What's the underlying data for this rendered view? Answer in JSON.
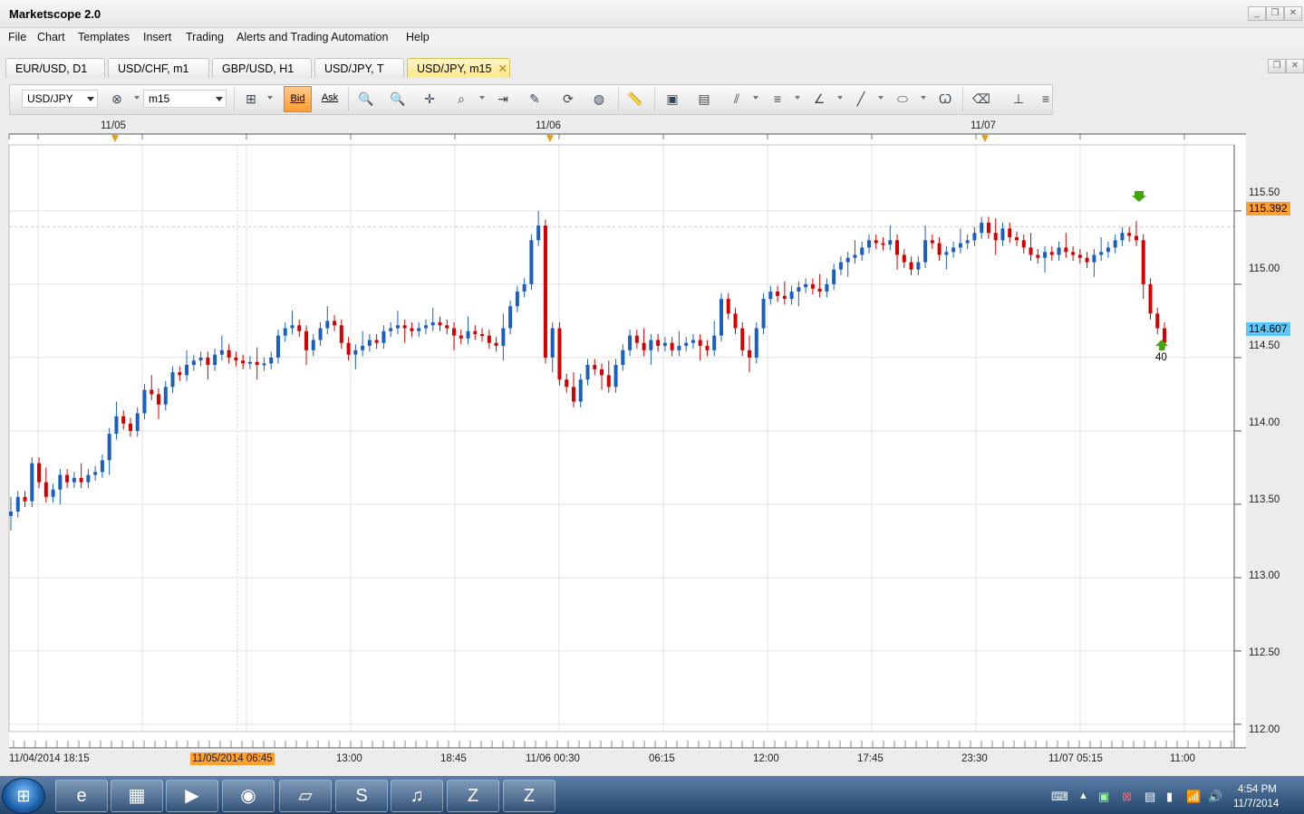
{
  "window": {
    "title": "Marketscope 2.0"
  },
  "menu": [
    "File",
    "Chart",
    "Templates",
    "Insert",
    "Trading",
    "Alerts and Trading Automation",
    "Help"
  ],
  "tabs": [
    {
      "label": "EUR/USD, D1",
      "active": false
    },
    {
      "label": "USD/CHF, m1",
      "active": false
    },
    {
      "label": "GBP/USD, H1",
      "active": false
    },
    {
      "label": "USD/JPY, T",
      "active": false
    },
    {
      "label": "USD/JPY, m15",
      "active": true
    }
  ],
  "toolbar": {
    "symbol": "USD/JPY",
    "timeframe": "m15",
    "bid_label": "Bid",
    "ask_label": "Ask"
  },
  "chart_data": {
    "type": "candlestick",
    "symbol": "USD/JPY",
    "timeframe": "m15",
    "top_date_labels": [
      "11/05",
      "11/06",
      "11/07"
    ],
    "x_tick_labels": [
      "11/04/2014 18:15",
      "11/05/2014 06:45",
      "13:00",
      "18:45",
      "11/06 00:30",
      "06:15",
      "12:00",
      "17:45",
      "23:30",
      "11/07 05:15",
      "11:00"
    ],
    "highlighted_time": "11/05/2014 06:45",
    "y_tick_labels": [
      "115.50",
      "115.00",
      "114.50",
      "114.00",
      "113.50",
      "113.00",
      "112.50",
      "112.00"
    ],
    "ylim": [
      111.95,
      115.95
    ],
    "current_ask": "115.392",
    "current_bid": "114.607",
    "signal_label": "40",
    "colors": {
      "up": "#1a5fbf",
      "down": "#d40000",
      "ask_tag": "#ff9f2f",
      "bid_tag": "#5ac8fa"
    },
    "closes": [
      113.45,
      113.55,
      113.52,
      113.78,
      113.65,
      113.55,
      113.6,
      113.7,
      113.65,
      113.68,
      113.65,
      113.7,
      113.72,
      113.8,
      113.98,
      114.1,
      114.05,
      114.0,
      114.12,
      114.28,
      114.25,
      114.18,
      114.3,
      114.4,
      114.38,
      114.45,
      114.48,
      114.5,
      114.45,
      114.52,
      114.55,
      114.5,
      114.48,
      114.46,
      114.47,
      114.45,
      114.46,
      114.5,
      114.65,
      114.7,
      114.72,
      114.68,
      114.55,
      114.62,
      114.7,
      114.75,
      114.72,
      114.6,
      114.52,
      114.55,
      114.58,
      114.62,
      114.6,
      114.68,
      114.7,
      114.72,
      114.7,
      114.68,
      114.7,
      114.72,
      114.74,
      114.72,
      114.7,
      114.65,
      114.63,
      114.68,
      114.66,
      114.65,
      114.6,
      114.58,
      114.7,
      114.85,
      114.95,
      115.0,
      115.3,
      115.4,
      114.5,
      114.7,
      114.35,
      114.3,
      114.2,
      114.35,
      114.45,
      114.42,
      114.38,
      114.3,
      114.45,
      114.55,
      114.65,
      114.6,
      114.55,
      114.62,
      114.58,
      114.6,
      114.55,
      114.58,
      114.6,
      114.62,
      114.58,
      114.55,
      114.65,
      114.9,
      114.8,
      114.7,
      114.55,
      114.5,
      114.7,
      114.9,
      114.95,
      114.92,
      114.9,
      114.95,
      114.98,
      115.0,
      114.97,
      114.95,
      115.0,
      115.1,
      115.15,
      115.18,
      115.2,
      115.25,
      115.3,
      115.28,
      115.27,
      115.3,
      115.2,
      115.15,
      115.1,
      115.15,
      115.3,
      115.28,
      115.2,
      115.22,
      115.25,
      115.28,
      115.3,
      115.35,
      115.42,
      115.35,
      115.3,
      115.38,
      115.32,
      115.3,
      115.25,
      115.2,
      115.18,
      115.22,
      115.2,
      115.25,
      115.22,
      115.2,
      115.18,
      115.15,
      115.2,
      115.22,
      115.25,
      115.3,
      115.35,
      115.33,
      115.3,
      115.0,
      114.8,
      114.7,
      114.6
    ]
  }
}
